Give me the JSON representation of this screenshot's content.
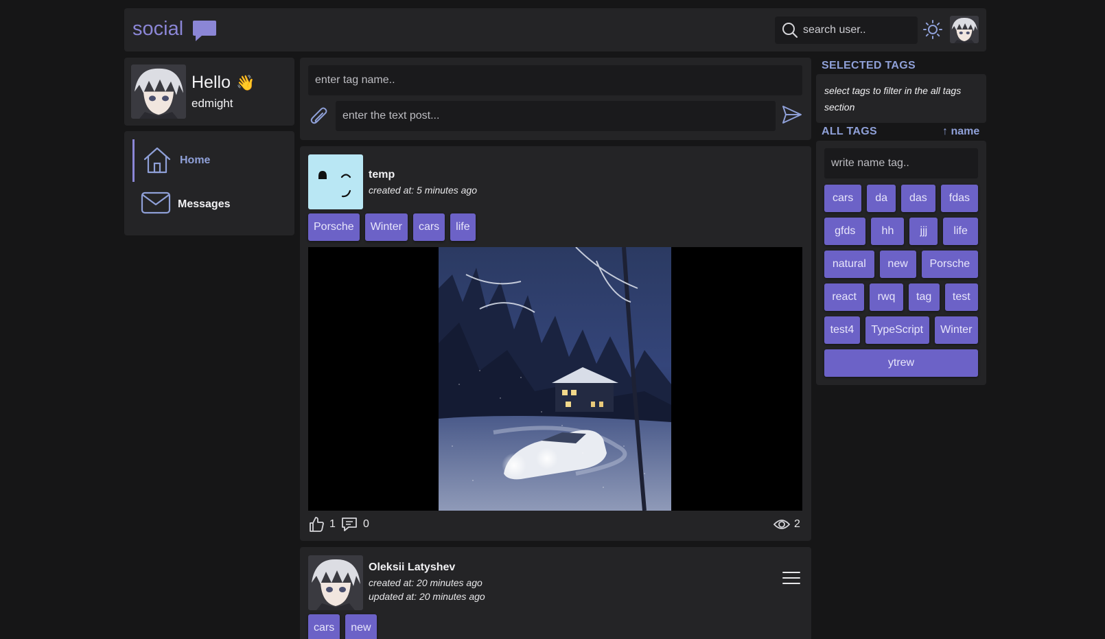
{
  "header": {
    "logo_text": "social",
    "search_placeholder": "search user.."
  },
  "profile": {
    "greeting": "Hello",
    "wave": "👋",
    "username": "edmight"
  },
  "nav": {
    "home_label": "Home",
    "messages_label": "Messages"
  },
  "composer": {
    "tag_placeholder": "enter tag name..",
    "text_placeholder": "enter the text post..."
  },
  "posts": [
    {
      "author": "temp",
      "created": "created at: 5 minutes ago",
      "tags": [
        "Porsche",
        "Winter",
        "cars",
        "life"
      ],
      "likes": "1",
      "comments": "0",
      "views": "2"
    },
    {
      "author": "Oleksii Latyshev",
      "created": "created at: 20 minutes ago",
      "updated": "updated at: 20 minutes ago",
      "tags": [
        "cars",
        "new"
      ]
    }
  ],
  "sidebar": {
    "selected_title": "SELECTED TAGS",
    "selected_hint": "select tags to filter in the all tags section",
    "all_title": "ALL TAGS",
    "sort_label": "↑ name",
    "filter_placeholder": "write name tag..",
    "tag_rows": [
      [
        "cars",
        "da",
        "das",
        "fdas"
      ],
      [
        "gfds",
        "hh",
        "jjj",
        "life"
      ],
      [
        "natural",
        "new",
        "Porsche"
      ],
      [
        "react",
        "rwq",
        "tag",
        "test"
      ],
      [
        "test4",
        "TypeScript",
        "Winter"
      ],
      [
        "ytrew"
      ]
    ]
  },
  "colors": {
    "background": "#161617",
    "panel": "#242426",
    "accent": "#6c62c7",
    "link": "#8fa0d8"
  }
}
